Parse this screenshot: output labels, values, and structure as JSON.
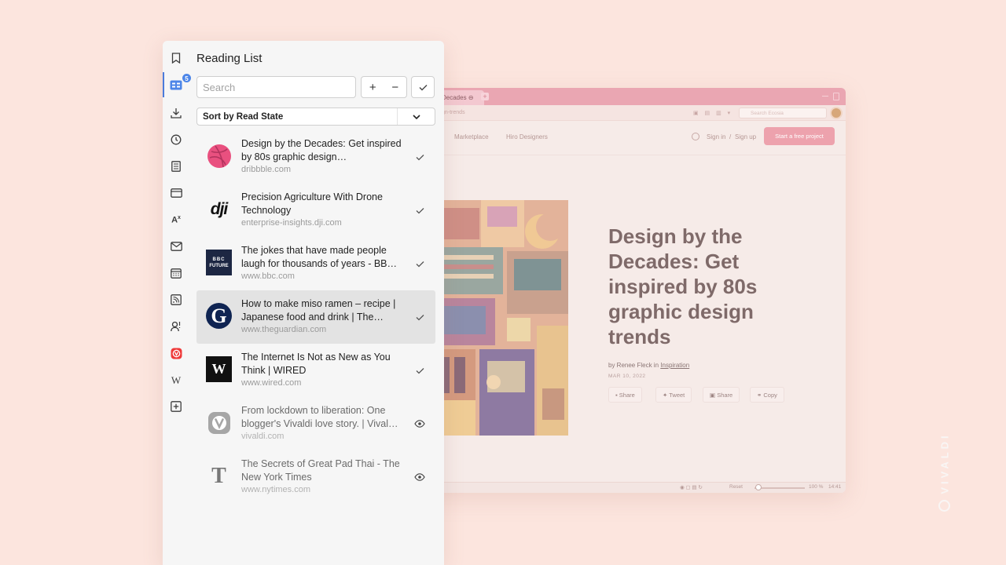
{
  "panel": {
    "title": "Reading List",
    "search_placeholder": "Search",
    "add_label": "+",
    "remove_label": "−",
    "sort_label": "Sort by Read State",
    "badge_count": "5"
  },
  "items": [
    {
      "title": "Design by the Decades: Get inspired by 80s graphic design…",
      "url": "dribbble.com",
      "state": "read"
    },
    {
      "title": "Precision Agriculture With Drone Technology",
      "url": "enterprise-insights.dji.com",
      "state": "read"
    },
    {
      "title": "The jokes that have made people laugh for thousands of years - BB…",
      "url": "www.bbc.com",
      "state": "read"
    },
    {
      "title": "How to make miso ramen – recipe | Japanese food and drink | The…",
      "url": "www.theguardian.com",
      "state": "read"
    },
    {
      "title": "The Internet Is Not as New as You Think | WIRED",
      "url": "www.wired.com",
      "state": "read"
    },
    {
      "title": "From lockdown to liberation: One blogger's Vivaldi love story. | Vival…",
      "url": "vivaldi.com",
      "state": "unread"
    },
    {
      "title": "The Secrets of Great Pad Thai - The New York Times",
      "url": "www.nytimes.com",
      "state": "unread"
    }
  ],
  "favicons": {
    "dji": "dji",
    "bbc_top": "BBC",
    "bbc_bottom": "FUTURE",
    "guardian": "G",
    "wired": "W",
    "nyt": "T"
  },
  "browser": {
    "tab_label": "Decades ⊖",
    "url_fragment": "gn-trends",
    "search_placeholder": "Search Ecosia",
    "nav": [
      "Marketplace",
      "Hiro Designers"
    ],
    "signin": "Sign in",
    "slash": "/",
    "signup": "Sign up",
    "cta": "Start a free project",
    "article_title": "Design by the Decades: Get inspired by 80s graphic design trends",
    "byline_prefix": "by Renee Fleck in",
    "byline_category": "Inspiration",
    "date": "MAR 10, 2022",
    "share_buttons": [
      "Share",
      "Tweet",
      "Share",
      "Copy"
    ],
    "status_reset": "Reset",
    "zoom": "100 %",
    "clock": "14:41"
  },
  "watermark": "VIVALDI",
  "colors": {
    "background": "#fce5de",
    "accent_blue": "#4d86e8",
    "vivaldi_red": "#ef3939",
    "dribbble_pink": "#e9507f"
  }
}
